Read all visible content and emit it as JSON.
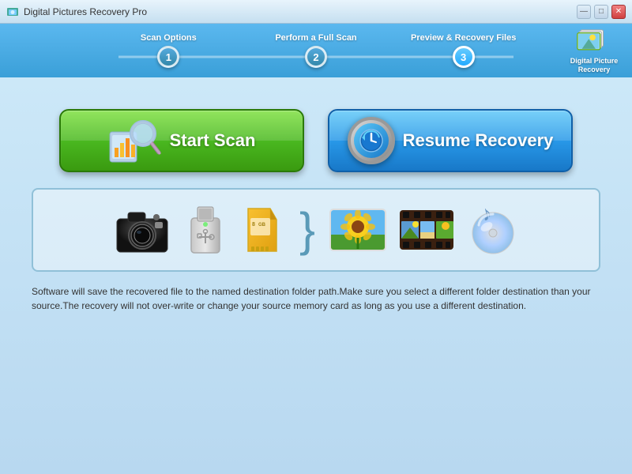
{
  "window": {
    "title": "Digital Pictures Recovery Pro",
    "controls": {
      "minimize": "—",
      "maximize": "□",
      "close": "✕"
    }
  },
  "steps": [
    {
      "label": "Scan Options",
      "number": "1"
    },
    {
      "label": "Perform a Full Scan",
      "number": "2"
    },
    {
      "label": "Preview & Recovery Files",
      "number": "3"
    }
  ],
  "logo": {
    "text": "Digital Picture\nRecovery"
  },
  "buttons": {
    "start_scan": "Start Scan",
    "resume_recovery": "Resume Recovery"
  },
  "description": "Software will save the recovered file to the named destination folder path.Make sure you select a different folder destination than your source.The recovery will not over-write or change your source memory card as long as you use a different destination."
}
